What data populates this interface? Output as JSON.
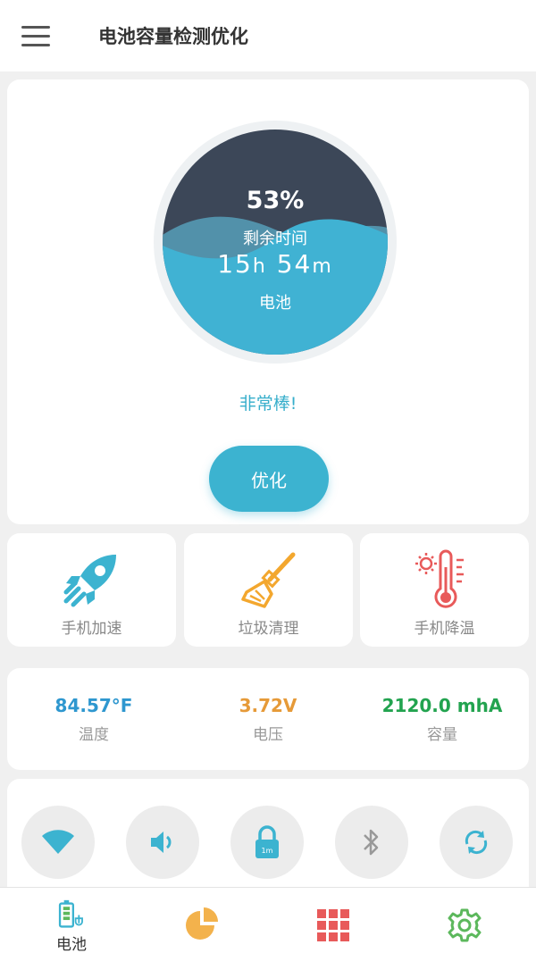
{
  "header": {
    "title": "电池容量检测优化",
    "menu_icon": "hamburger-menu-icon"
  },
  "battery": {
    "percent": "53%",
    "remaining_label": "剩余时间",
    "hours": "15",
    "hours_unit": "h",
    "minutes": "54",
    "minutes_unit": "m",
    "battery_label": "电池",
    "level": 0.53,
    "status": "非常棒!",
    "optimize_label": "优化"
  },
  "tools": [
    {
      "label": "手机加速",
      "icon": "rocket-icon"
    },
    {
      "label": "垃圾清理",
      "icon": "broom-icon"
    },
    {
      "label": "手机降温",
      "icon": "thermometer-icon"
    }
  ],
  "stats": [
    {
      "value": "84.57°F",
      "label": "温度",
      "color": "#2e97cf"
    },
    {
      "value": "3.72V",
      "label": "电压",
      "color": "#e69a38"
    },
    {
      "value": "2120.0 mhA",
      "label": "容量",
      "color": "#22a34f"
    }
  ],
  "toggles": [
    {
      "name": "wifi",
      "icon": "wifi-icon"
    },
    {
      "name": "volume",
      "icon": "volume-icon"
    },
    {
      "name": "screen-lock",
      "icon": "lock-icon",
      "badge": "1m"
    },
    {
      "name": "bluetooth",
      "icon": "bluetooth-icon"
    },
    {
      "name": "auto-rotate",
      "icon": "sync-icon"
    }
  ],
  "bottom_nav": [
    {
      "label": "电池",
      "icon": "battery-icon"
    },
    {
      "label": "",
      "icon": "pie-chart-icon"
    },
    {
      "label": "",
      "icon": "grid-icon"
    },
    {
      "label": "",
      "icon": "settings-gear-icon"
    }
  ],
  "colors": {
    "accent": "#3cb3d0",
    "dark": "#3c4758",
    "orange": "#f3a72e",
    "red": "#e85a5a",
    "green": "#5cb85c"
  }
}
